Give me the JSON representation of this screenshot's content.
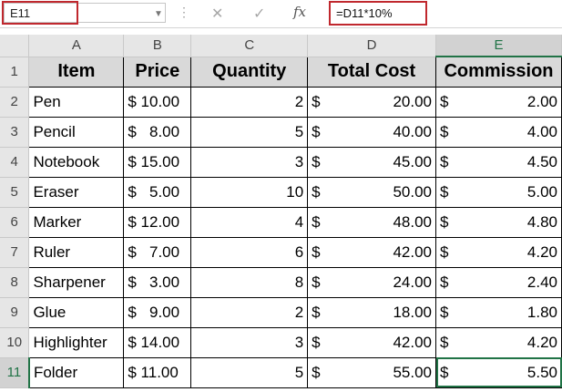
{
  "formula_bar": {
    "name_box": "E11",
    "cancel_icon": "✕",
    "enter_icon": "✓",
    "fx_label": "fx",
    "formula": "=D11*10%"
  },
  "columns": [
    "A",
    "B",
    "C",
    "D",
    "E"
  ],
  "row_numbers": [
    "1",
    "2",
    "3",
    "4",
    "5",
    "6",
    "7",
    "8",
    "9",
    "10",
    "11"
  ],
  "headers": {
    "item": "Item",
    "price": "Price",
    "quantity": "Quantity",
    "total_cost": "Total Cost",
    "commission": "Commission"
  },
  "currency_symbol": "$",
  "rows": [
    {
      "item": "Pen",
      "price": "$ 10.00",
      "quantity": "2",
      "total": "20.00",
      "commission": "2.00"
    },
    {
      "item": "Pencil",
      "price": "$   8.00",
      "quantity": "5",
      "total": "40.00",
      "commission": "4.00"
    },
    {
      "item": "Notebook",
      "price": "$ 15.00",
      "quantity": "3",
      "total": "45.00",
      "commission": "4.50"
    },
    {
      "item": "Eraser",
      "price": "$   5.00",
      "quantity": "10",
      "total": "50.00",
      "commission": "5.00"
    },
    {
      "item": "Marker",
      "price": "$ 12.00",
      "quantity": "4",
      "total": "48.00",
      "commission": "4.80"
    },
    {
      "item": "Ruler",
      "price": "$   7.00",
      "quantity": "6",
      "total": "42.00",
      "commission": "4.20"
    },
    {
      "item": "Sharpener",
      "price": "$   3.00",
      "quantity": "8",
      "total": "24.00",
      "commission": "2.40"
    },
    {
      "item": "Glue",
      "price": "$   9.00",
      "quantity": "2",
      "total": "18.00",
      "commission": "1.80"
    },
    {
      "item": "Highlighter",
      "price": "$ 14.00",
      "quantity": "3",
      "total": "42.00",
      "commission": "4.20"
    },
    {
      "item": "Folder",
      "price": "$ 11.00",
      "quantity": "5",
      "total": "55.00",
      "commission": "5.50"
    }
  ],
  "colors": {
    "highlight_box": "#c0282e",
    "selection": "#217346",
    "header_fill": "#d9d9d9"
  }
}
